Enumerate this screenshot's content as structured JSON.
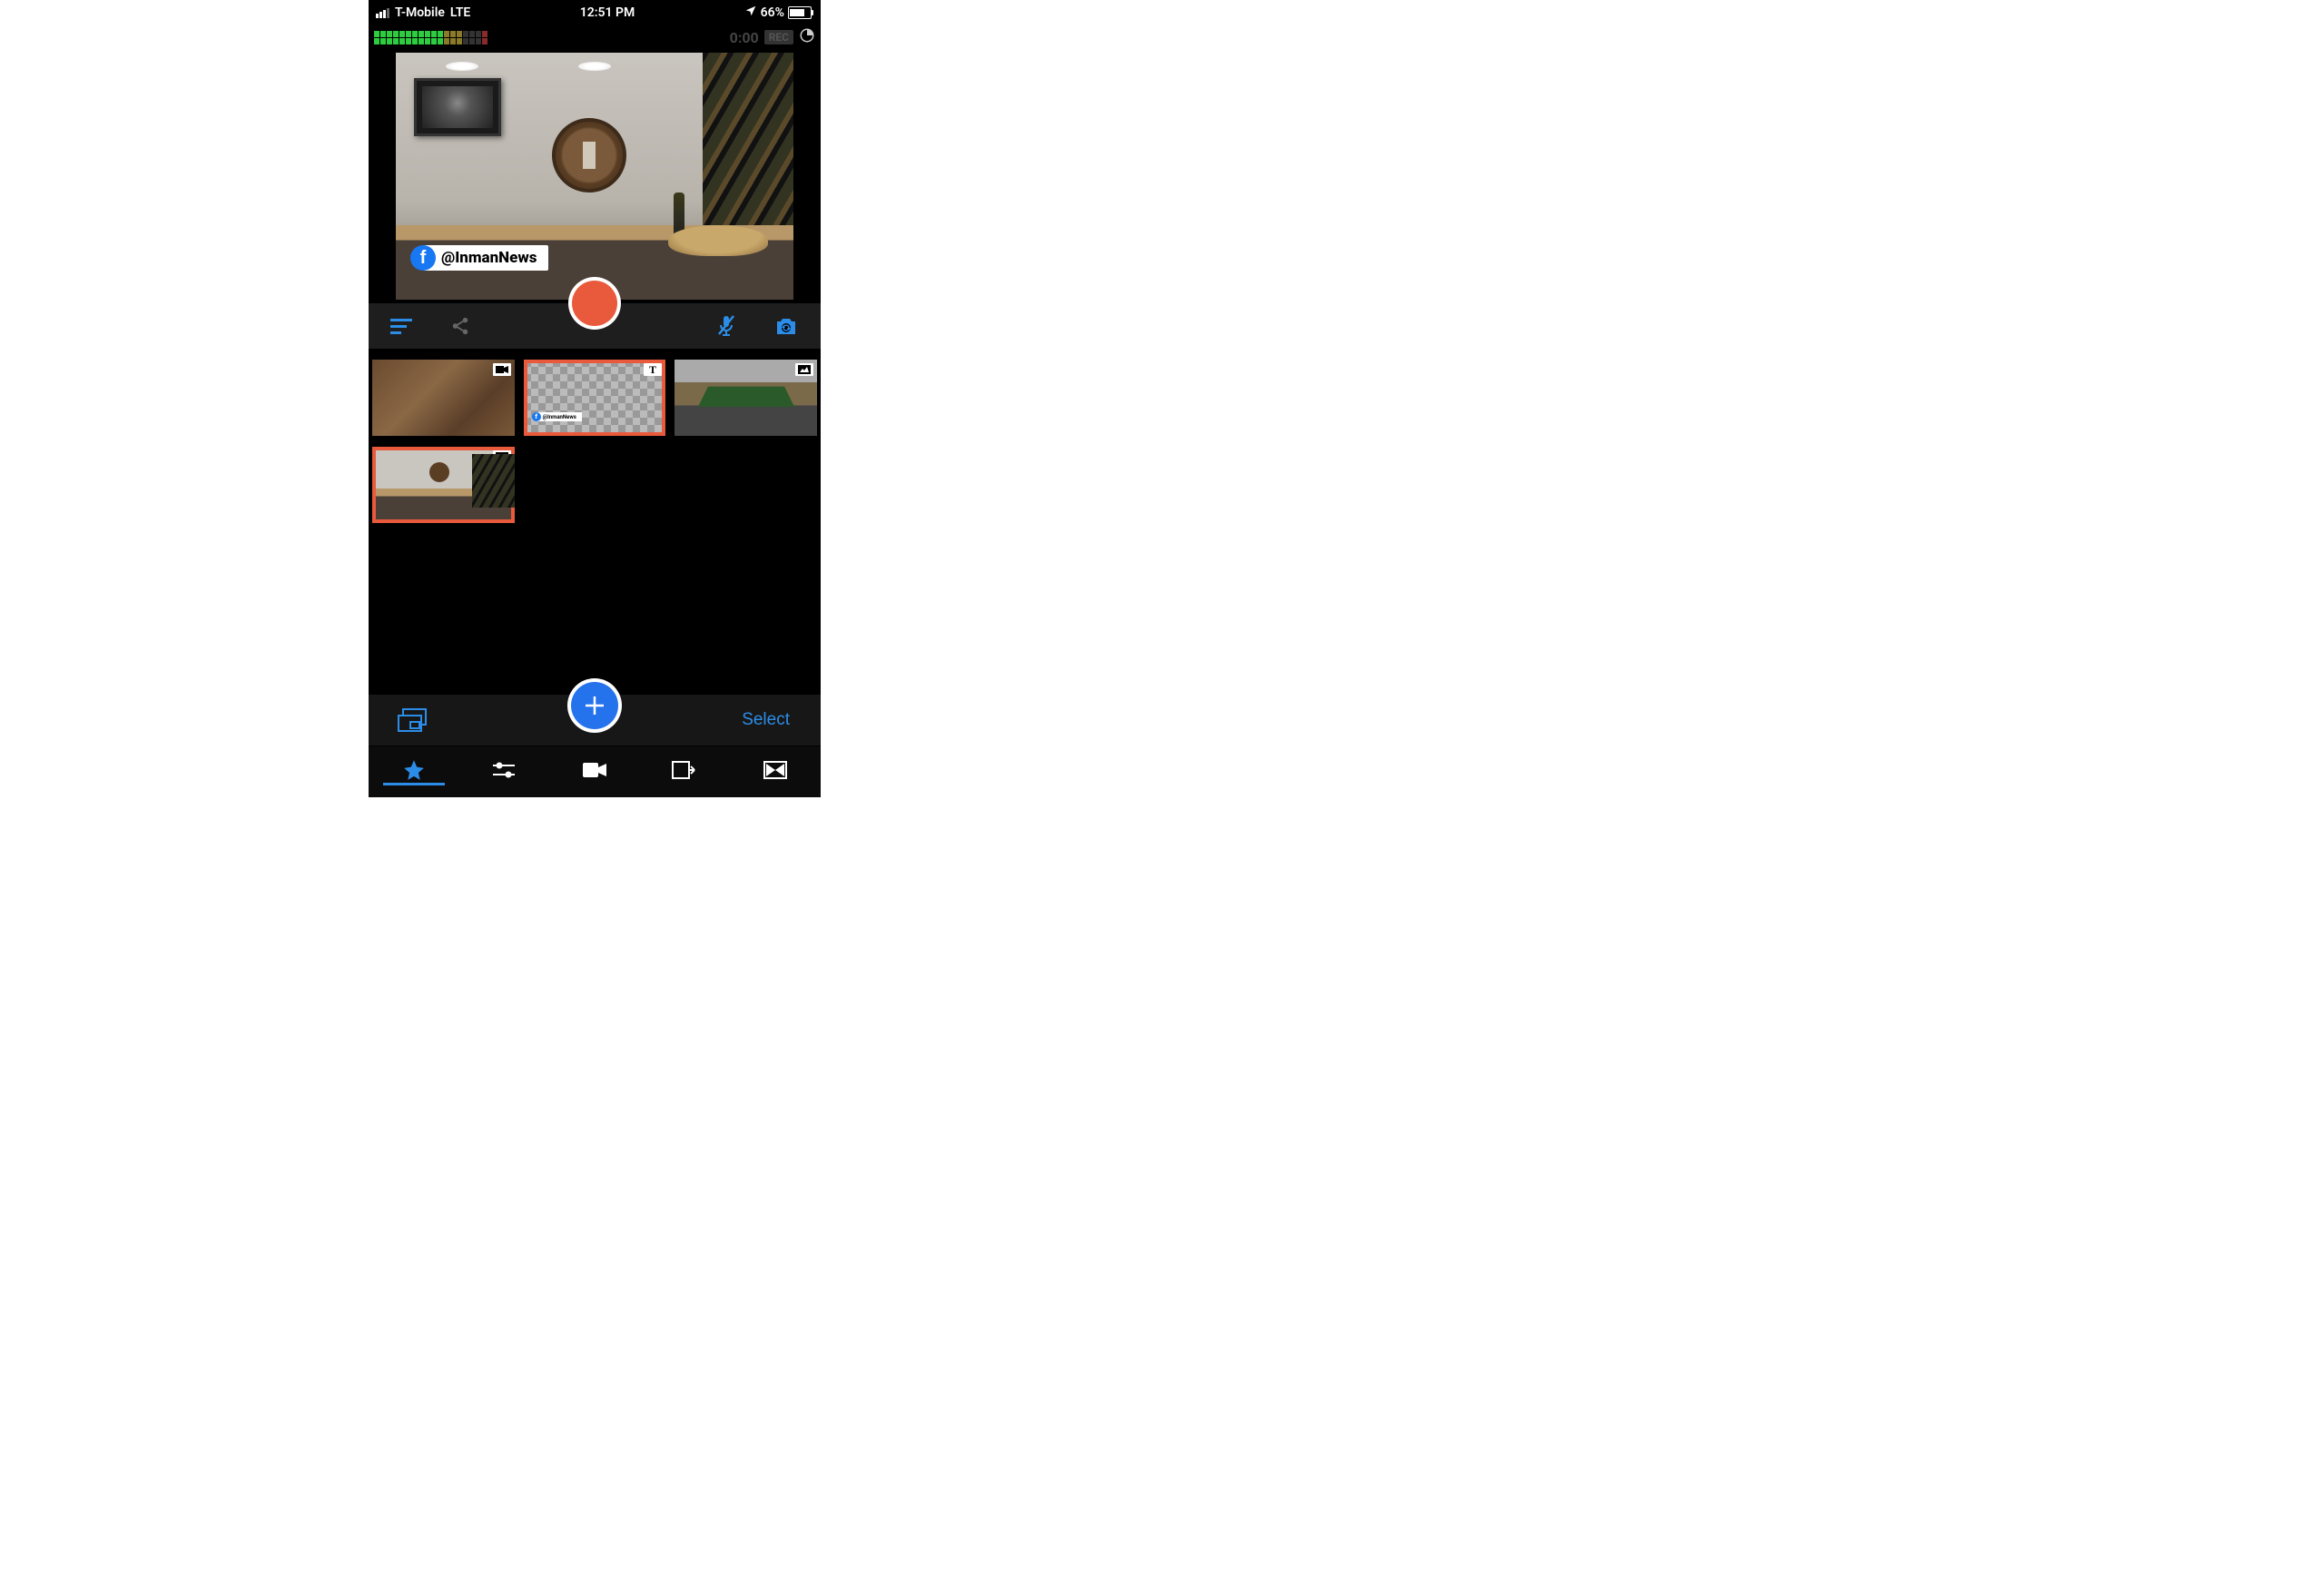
{
  "status_bar": {
    "carrier": "T-Mobile",
    "network": "LTE",
    "time": "12:51 PM",
    "battery_pct": "66%"
  },
  "rec_bar": {
    "timer": "0:00",
    "rec_label": "REC"
  },
  "preview": {
    "overlay_handle": "@InmanNews"
  },
  "clips": {
    "mini_handle": "@InmanNews"
  },
  "select_bar": {
    "select_label": "Select"
  }
}
